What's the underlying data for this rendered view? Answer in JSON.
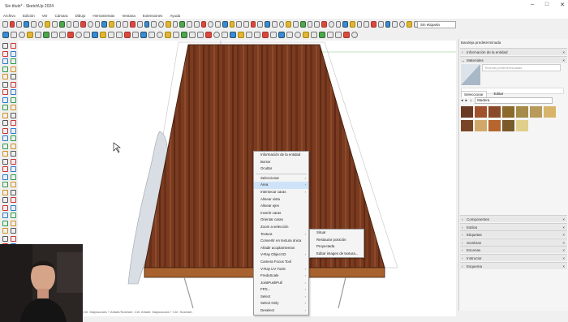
{
  "window": {
    "title": "Sin título* - SketchUp 2024"
  },
  "menu": [
    "Archivo",
    "Edición",
    "Ver",
    "Cámara",
    "Dibujo",
    "Herramientas",
    "Ventana",
    "Extensiones",
    "Ayuda"
  ],
  "tag_selector": {
    "value": "Sin etiqueta"
  },
  "panel": {
    "title": "Bandeja predeterminada",
    "entity_info": "Información de la entidad",
    "materials": "Materiales",
    "material_placeholder": "Texturas predeterminadas",
    "tabs": [
      "Seleccionar",
      "Editar"
    ],
    "library": "Madera",
    "sections": [
      "Componentes",
      "Estilos",
      "Etiquetas",
      "Sombras",
      "Escenas",
      "Instructor",
      "Esquema"
    ]
  },
  "context_menu": {
    "items": [
      {
        "label": "Información de la entidad",
        "sub": false
      },
      {
        "label": "Borrar",
        "sub": false
      },
      {
        "label": "Ocultar",
        "sub": false
      },
      {
        "sep": true
      },
      {
        "label": "Seleccionar",
        "sub": true
      },
      {
        "label": "Área",
        "sub": true,
        "highlight": true
      },
      {
        "label": "Intersecar caras",
        "sub": true
      },
      {
        "label": "Alinear vista",
        "sub": false
      },
      {
        "label": "Alinear ejes",
        "sub": false
      },
      {
        "label": "Invertir caras",
        "sub": false
      },
      {
        "label": "Orientar caras",
        "sub": false
      },
      {
        "label": "Zoom a selección",
        "sub": false
      },
      {
        "label": "Textura",
        "sub": true
      },
      {
        "label": "Convertir en textura única",
        "sub": false
      },
      {
        "label": "Añadir acoplamientos",
        "sub": false
      },
      {
        "label": "V-Ray Object ID",
        "sub": true
      },
      {
        "label": "Camera Focus Tool",
        "sub": false
      },
      {
        "label": "V-Ray UV Tools",
        "sub": true
      },
      {
        "label": "FredoScale",
        "sub": true
      },
      {
        "label": "JointPushPull",
        "sub": true
      },
      {
        "label": "FFD...",
        "sub": true
      },
      {
        "label": "Select",
        "sub": true
      },
      {
        "label": "Select Only",
        "sub": true
      },
      {
        "label": "Deselect",
        "sub": true
      }
    ]
  },
  "texture_submenu": [
    "Situar",
    "Restaurar posición",
    "Proyectada",
    "Editar imagen de textura..."
  ],
  "status": "Ctrl. Mayúsculas + Añadir/Sustraer. Ctrl. Añadir. Mayúsculas + Ctrl. Sustraer.",
  "colors": {
    "wood": "#7a3b20",
    "accent": "#cfe3f8"
  }
}
